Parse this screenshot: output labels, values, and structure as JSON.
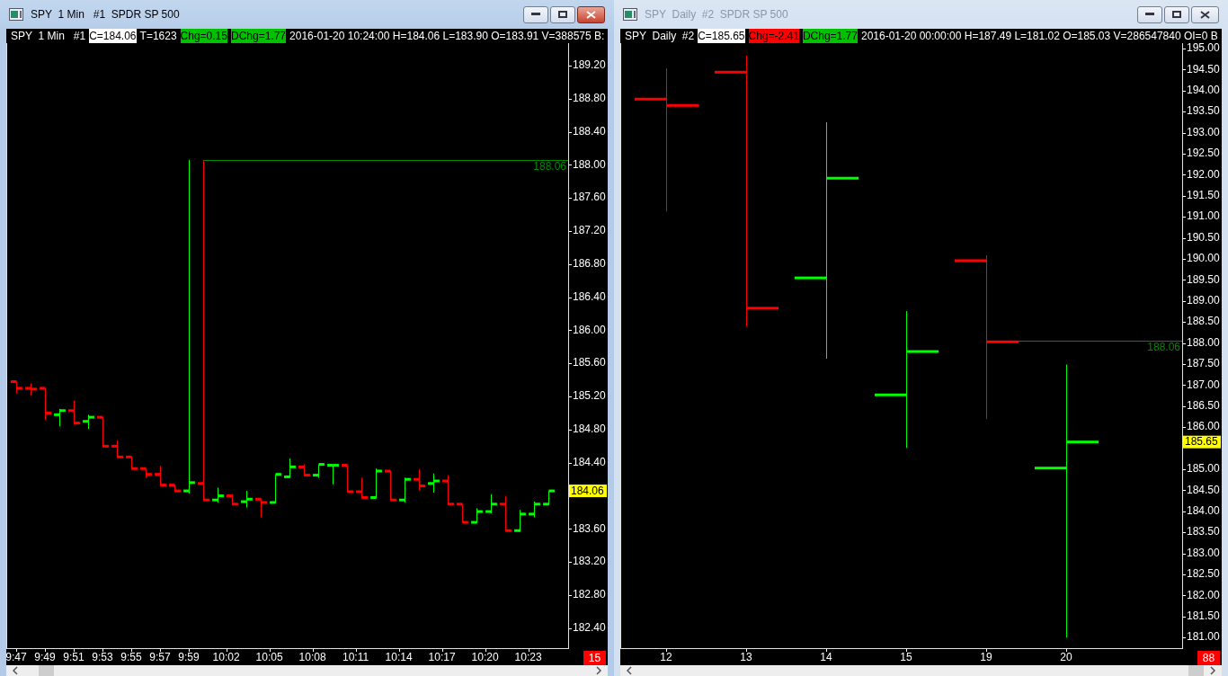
{
  "windows": [
    {
      "title": "SPY  1 Min   #1  SPDR SP 500",
      "active": true,
      "header": [
        {
          "text": "SPY  1 Min   #1",
          "kind": "plain"
        },
        {
          "text": "C=184.06",
          "kind": "value"
        },
        {
          "text": "T=1623",
          "kind": "plain"
        },
        {
          "text": "Chg=0.15",
          "kind": "up"
        },
        {
          "text": "DChg=1.77",
          "kind": "up"
        },
        {
          "text": "2016-01-20 10:24:00 H=184.06 L=183.90 O=183.91 V=388575 B:",
          "kind": "plain"
        }
      ],
      "price_axis": [
        "189.20",
        "188.80",
        "188.40",
        "188.00",
        "187.60",
        "187.20",
        "186.80",
        "186.40",
        "186.00",
        "185.60",
        "185.20",
        "184.80",
        "184.40",
        "183.60",
        "183.20",
        "182.80",
        "182.40"
      ],
      "time_axis": [
        "9:47",
        "9:49",
        "9:51",
        "9:53",
        "9:55",
        "9:57",
        "9:59",
        "10:02",
        "10:05",
        "10:08",
        "10:11",
        "10:14",
        "10:17",
        "10:20",
        "10:23"
      ],
      "level_price": "188.06",
      "last_price": "184.06",
      "badge": "15"
    },
    {
      "title": "SPY  Daily  #2  SPDR SP 500",
      "active": false,
      "header": [
        {
          "text": "SPY  Daily  #2",
          "kind": "plain"
        },
        {
          "text": "C=185.65",
          "kind": "value"
        },
        {
          "text": "Chg=-2.41",
          "kind": "down"
        },
        {
          "text": "DChg=1.77",
          "kind": "up"
        },
        {
          "text": "2016-01-20 00:00:00 H=187.49 L=181.02 O=185.03 V=286547840 OI=0 B",
          "kind": "plain"
        }
      ],
      "price_axis": [
        "195.00",
        "194.50",
        "194.00",
        "193.50",
        "193.00",
        "192.50",
        "192.00",
        "191.50",
        "191.00",
        "190.50",
        "190.00",
        "189.50",
        "189.00",
        "188.50",
        "188.00",
        "187.50",
        "187.00",
        "186.50",
        "186.00",
        "185.00",
        "184.50",
        "184.00",
        "183.50",
        "183.00",
        "182.50",
        "182.00",
        "181.50",
        "181.00"
      ],
      "time_axis": [
        "12",
        "13",
        "14",
        "15",
        "19",
        "20"
      ],
      "level_price": "188.06",
      "last_price": "185.65",
      "badge": "88"
    }
  ]
}
